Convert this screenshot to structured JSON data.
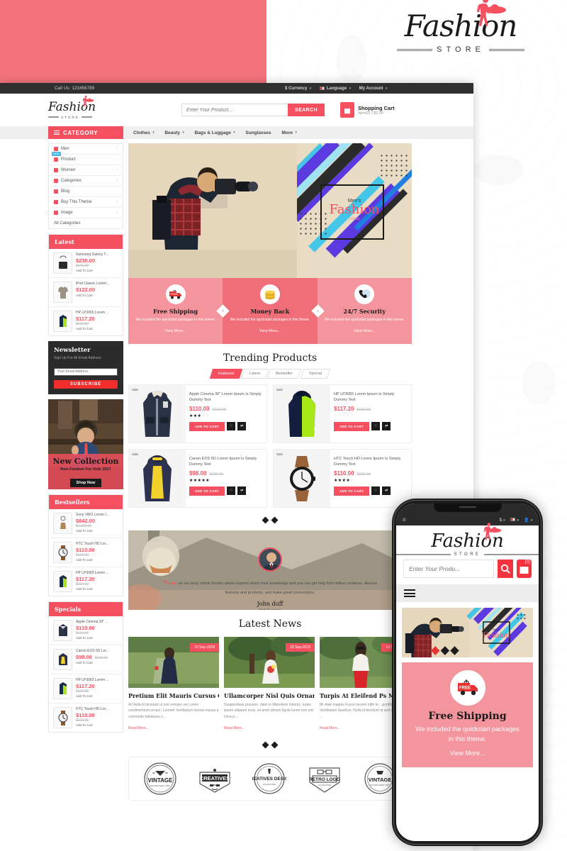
{
  "brand": {
    "name": "Fashion",
    "sub": "STORE"
  },
  "topbar": {
    "call": "Call Us: 123456789",
    "currency": "$ Currency",
    "language": "Language",
    "account": "My Account"
  },
  "header": {
    "search_placeholder": "Enter Your Product....",
    "search_button": "SEARCH",
    "cart_title": "Shopping Cart",
    "cart_sub": "Item(0) / $0.00"
  },
  "nav": {
    "category_label": "CATEGORY",
    "links": [
      "Clothes",
      "Beauty",
      "Bags & Luggage",
      "Sunglasses",
      "More"
    ]
  },
  "sidebar": {
    "categories": [
      {
        "label": "Men",
        "arrow": true,
        "badge": ""
      },
      {
        "label": "Product",
        "arrow": true,
        "badge": "NEW"
      },
      {
        "label": "Women",
        "arrow": true,
        "badge": ""
      },
      {
        "label": "Categories",
        "arrow": true,
        "badge": ""
      },
      {
        "label": "Blog",
        "arrow": false,
        "badge": ""
      },
      {
        "label": "Buy This Theme",
        "arrow": true,
        "badge": ""
      },
      {
        "label": "Image",
        "arrow": true,
        "badge": ""
      }
    ],
    "all_categories": "All Categories",
    "latest": {
      "title": "Latest",
      "items": [
        {
          "name": "Samsung Galaxy T...",
          "new": "$230.00",
          "old": "$241.99",
          "cta": "Add To Cart"
        },
        {
          "name": "iPod Classic Lorem...",
          "new": "$122.00",
          "old": "",
          "cta": "Add To Cart"
        },
        {
          "name": "HP LP3065 Lorem ...",
          "new": "$117.20",
          "old": "$122.00",
          "cta": "Add To Cart"
        }
      ]
    },
    "newsletter": {
      "title": "Newsletter",
      "subtitle": "Sign Up For All Email Address",
      "placeholder": "Your Email Address",
      "button": "SUBSCRIBE"
    },
    "collection": {
      "title": "New Collection",
      "subtitle": "New Fashion For Kids 2017",
      "button": "Shop Now"
    },
    "bestsellers": {
      "title": "Bestsellers",
      "items": [
        {
          "name": "Sony VAIO Lorem I...",
          "new": "$842.00",
          "old": "$1,202.00",
          "cta": "Add To Cart"
        },
        {
          "name": "HTC Touch HD Lor...",
          "new": "$110.00",
          "old": "$122.00",
          "cta": "Add To Cart"
        },
        {
          "name": "HP LP3065 Lorem ...",
          "new": "$117.20",
          "old": "$122.00",
          "cta": "Add To Cart"
        }
      ]
    },
    "specials": {
      "title": "Specials",
      "items": [
        {
          "name": "Apple Cinema 30\" ...",
          "new": "$110.00",
          "old": "$122.00",
          "cta": "Add To Cart"
        },
        {
          "name": "Canon EOS 5D Lor...",
          "new": "$98.00",
          "old": "$122.00",
          "cta": "Add To Cart"
        },
        {
          "name": "HP LP3065 Lorem ...",
          "new": "$117.20",
          "old": "$122.00",
          "cta": "Add To Cart"
        },
        {
          "name": "HTC Touch HD Lor...",
          "new": "$110.00",
          "old": "$122.00",
          "cta": "Add To Cart"
        }
      ]
    }
  },
  "hero": {
    "kicker": "Men's",
    "title": "Fashion",
    "sub": "cloths"
  },
  "services": [
    {
      "title": "Free Shipping",
      "desc": "We included the quickstart packages in this theme.",
      "link": "View More...",
      "icon": "truck-icon"
    },
    {
      "title": "Money Back",
      "desc": "We included the quickstart packages in this theme.",
      "link": "View More...",
      "icon": "coins-icon"
    },
    {
      "title": "24/7 Security",
      "desc": "We included the quickstart packages in this theme.",
      "link": "View More...",
      "icon": "support-icon"
    }
  ],
  "trending": {
    "title": "Trending Products",
    "tabs": [
      "Featured",
      "Latest",
      "Bestseller",
      "Special"
    ],
    "active_tab": "Featured",
    "sale_label": "Sale",
    "add_to_cart": "ADD TO CART",
    "products": [
      {
        "title": "Apple Cinema 30\" Lorem Ipsum Is Simply Dummy Text",
        "new": "$110.00",
        "old": "$122.00",
        "rating": 3,
        "img": "jacket-navy"
      },
      {
        "title": "HP LP3065 Lorem Ipsum Is Simply Dummy Text",
        "new": "$117.20",
        "old": "$122.00",
        "rating": 0,
        "img": "jacket-green"
      },
      {
        "title": "Canon EOS 5D Lorem Ipsum Is Simply Dummy Text",
        "new": "$98.00",
        "old": "$122.00",
        "rating": 5,
        "img": "jacket-yellow"
      },
      {
        "title": "HTC Touch HD Lorem Ipsum Is Simply Dummy Text",
        "new": "$110.00",
        "old": "$122.00",
        "rating": 4,
        "img": "watch-brown"
      }
    ]
  },
  "testimonial": {
    "highlight": "Jump",
    "text": " on our busy online forums where experts share their knowledge and you can get help from fellow creatives, discuss features and products, and make great connections.",
    "name": "John duff",
    "role": "Web Designer"
  },
  "news": {
    "title": "Latest News",
    "read_more": "Read More...",
    "items": [
      {
        "date": "10 Sep-2018",
        "title": "Pretium Elit Mauris Cursus C...",
        "excerpt": "At Nulla id tincidunt ut sed semper vel Lorem condimentum ornare. Laoreet Vestibulum lacinia massa a commodo habitasse v..."
      },
      {
        "date": "10 Sep-2018",
        "title": "Ullamcorper Nisl Quis Ornare...",
        "excerpt": "Suspendisse posuere, diam in bibendum lobortis, turpis ipsum aliquam risus, sit amet dictum ligula lorem non nisl Urna p..."
      },
      {
        "date": "10 Sep-2018",
        "title": "Turpis At Eleifend Ps Mi E...",
        "excerpt": "Mi vitae magnis Fusce laoreet nibh fe... porttitor laoreet Vestibulum faucibus. Nulla id tincidunt ut sed semper vel ..."
      }
    ]
  },
  "brands": [
    {
      "name": "VINTAGE",
      "sub": "ESTABLISHED 1987"
    },
    {
      "name": "CREATIVES",
      "sub": ""
    },
    {
      "name": "CREATIVES DESIGN",
      "sub": "GUARANTEE"
    },
    {
      "name": "RETRO LOGO",
      "sub": "GUARANTEE"
    },
    {
      "name": "VINTAGE",
      "sub": "ESTABLISHED 1987"
    }
  ],
  "phone": {
    "search_placeholder": "Enter Your Produ...",
    "cart_count": "(0)",
    "service": {
      "title": "Free Shipping",
      "desc": "We included the quickstart packages in this theme.",
      "link": "View More..."
    }
  },
  "colors": {
    "accent": "#f4505f",
    "accent_soft": "#f4949c",
    "accent_banner": "#f4737c",
    "dark": "#2b2b2b"
  }
}
